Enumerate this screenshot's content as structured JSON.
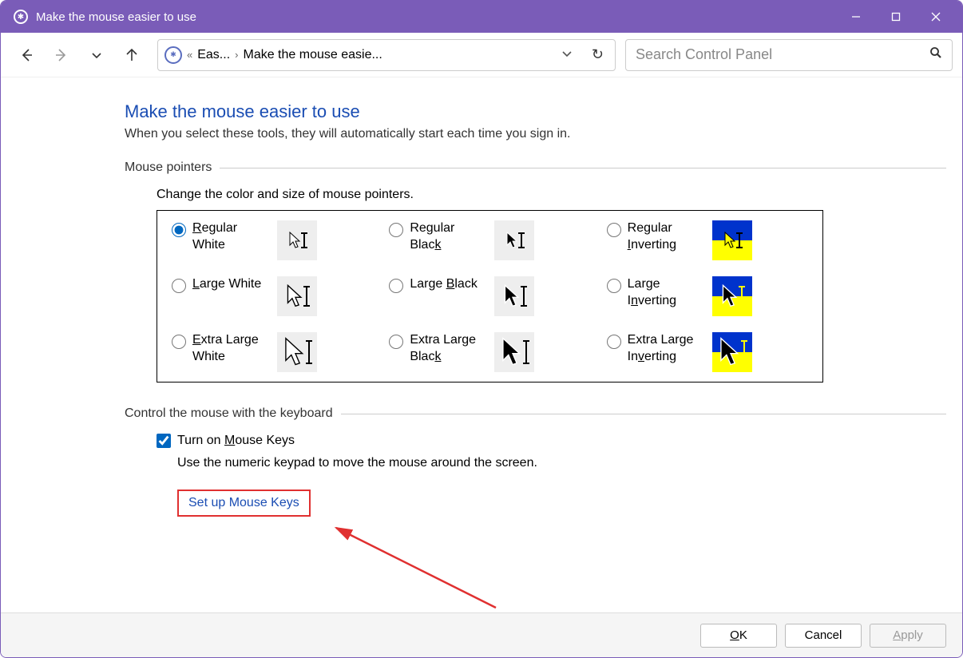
{
  "window": {
    "title": "Make the mouse easier to use"
  },
  "breadcrumb": {
    "prev": "Eas...",
    "current": "Make the mouse easie..."
  },
  "search": {
    "placeholder": "Search Control Panel"
  },
  "page": {
    "title": "Make the mouse easier to use",
    "subtitle": "When you select these tools, they will automatically start each time you sign in."
  },
  "sections": {
    "pointers": {
      "header": "Mouse pointers",
      "desc": "Change the color and size of mouse pointers.",
      "options": [
        "Regular White",
        "Regular Black",
        "Regular Inverting",
        "Large White",
        "Large Black",
        "Large Inverting",
        "Extra Large White",
        "Extra Large Black",
        "Extra Large Inverting"
      ],
      "selected": 0
    },
    "keyboard": {
      "header": "Control the mouse with the keyboard",
      "checkbox_label": "Turn on Mouse Keys",
      "checkbox_checked": true,
      "desc": "Use the numeric keypad to move the mouse around the screen.",
      "link": "Set up Mouse Keys"
    }
  },
  "buttons": {
    "ok": "OK",
    "cancel": "Cancel",
    "apply": "Apply"
  }
}
